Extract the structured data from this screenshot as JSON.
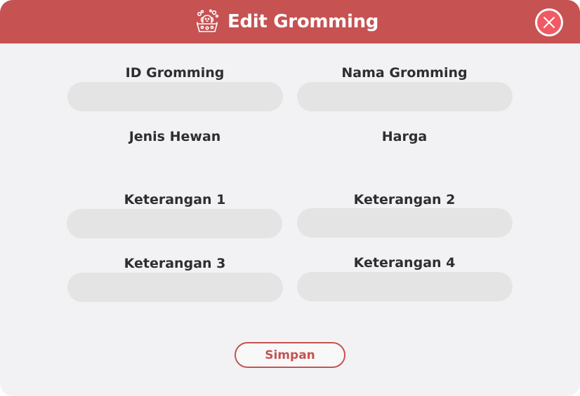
{
  "dialog": {
    "title": "Edit Gromming",
    "header_icon": "pet-grooming-icon",
    "close_icon": "close-icon",
    "colors": {
      "header": "#c65252",
      "close_accent": "#f05a64",
      "body": "#f2f2f4",
      "input": "#e4e4e4"
    }
  },
  "fields": {
    "id_gromming": {
      "label": "ID Gromming",
      "value": ""
    },
    "nama_gromming": {
      "label": "Nama Gromming",
      "value": ""
    },
    "jenis_hewan": {
      "label": "Jenis Hewan"
    },
    "harga": {
      "label": "Harga"
    },
    "keterangan_1": {
      "label": "Keterangan 1",
      "value": ""
    },
    "keterangan_2": {
      "label": "Keterangan 2",
      "value": ""
    },
    "keterangan_3": {
      "label": "Keterangan 3",
      "value": ""
    },
    "keterangan_4": {
      "label": "Keterangan 4",
      "value": ""
    }
  },
  "actions": {
    "save_label": "Simpan"
  }
}
